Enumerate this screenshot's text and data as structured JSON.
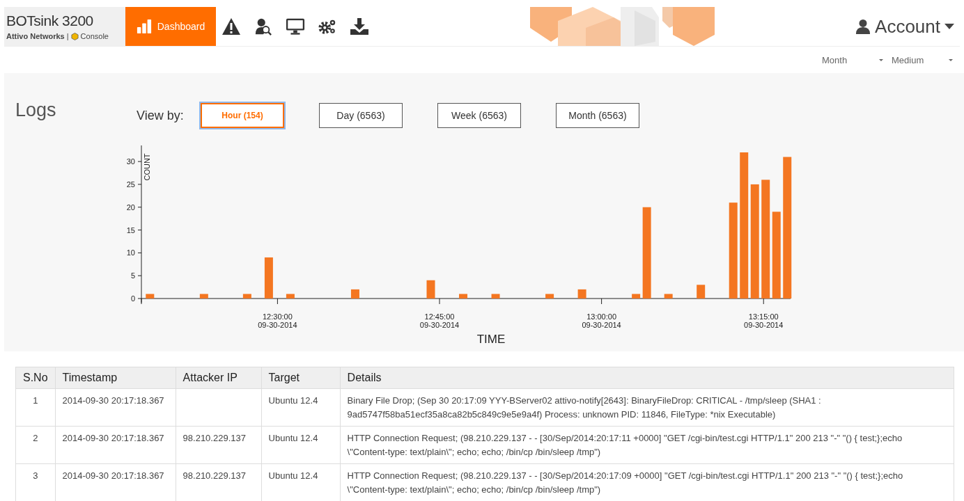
{
  "header": {
    "product": "BOTsink 3200",
    "company": "Attivo Networks",
    "separator": "|",
    "console": "Console",
    "nav": [
      {
        "kind": "tab",
        "label": "Dashboard",
        "selected": true
      },
      {
        "kind": "icon",
        "selected": false
      },
      {
        "kind": "icon",
        "selected": false
      },
      {
        "kind": "icon",
        "selected": false
      },
      {
        "kind": "icon",
        "selected": false
      },
      {
        "kind": "icon",
        "selected": false
      }
    ],
    "account": "Account"
  },
  "filters": [
    "Month",
    "Medium"
  ],
  "logs": {
    "title": "Logs",
    "view_by_label": "View by:",
    "views": [
      {
        "label": "Hour (154)",
        "selected": true
      },
      {
        "label": "Day (6563)",
        "selected": false
      },
      {
        "label": "Week (6563)",
        "selected": false
      },
      {
        "label": "Month (6563)",
        "selected": false
      }
    ],
    "chart_data": {
      "type": "bar",
      "xlabel": "TIME",
      "ylabel": "COUNT",
      "categories": [
        null,
        null,
        null,
        null,
        null,
        null,
        null,
        null,
        null,
        null,
        null,
        null,
        "12:30:00 09-30-2014",
        null,
        null,
        null,
        null,
        null,
        null,
        null,
        null,
        null,
        null,
        null,
        null,
        null,
        null,
        "12:45:00 09-30-2014",
        null,
        null,
        null,
        null,
        null,
        null,
        null,
        null,
        null,
        null,
        null,
        null,
        null,
        null,
        "13:00:00 09-30-2014",
        null,
        null,
        null,
        null,
        null,
        null,
        null,
        null,
        null,
        null,
        null,
        null,
        null,
        null,
        "13:15:00 09-30-2014",
        null,
        null
      ],
      "series": [
        {
          "color": "#f47621",
          "values": [
            1,
            null,
            null,
            null,
            null,
            1,
            null,
            null,
            null,
            1,
            null,
            9,
            null,
            1,
            null,
            null,
            null,
            null,
            null,
            2,
            null,
            null,
            null,
            null,
            null,
            null,
            4,
            null,
            null,
            1,
            null,
            null,
            1,
            null,
            null,
            null,
            null,
            1,
            null,
            null,
            2,
            null,
            null,
            null,
            null,
            1,
            20,
            null,
            1,
            null,
            null,
            3,
            null,
            null,
            21,
            32,
            25,
            26,
            19,
            31
          ]
        }
      ],
      "ylim": [
        0,
        32
      ],
      "yticks": [
        0,
        5,
        10,
        15,
        20,
        25,
        30
      ]
    }
  },
  "table": {
    "columns": [
      "S.No",
      "Timestamp",
      "Attacker IP",
      "Target",
      "Details"
    ],
    "rows": [
      [
        "1",
        "2014-09-30 20:17:18.367",
        "",
        "Ubuntu 12.4",
        "Binary File Drop; (Sep 30 20:17:09 YYY-BServer02 attivo-notify[2643]: BinaryFileDrop: CRITICAL - /tmp/sleep (SHA1 : 9ad5747f58ba51ecf35a8ca82b5c849c9e5e9a4f) Process: unknown PID: 11846, FileType: *nix Executable)"
      ],
      [
        "2",
        "2014-09-30 20:17:18.367",
        "98.210.229.137",
        "Ubuntu 12.4",
        "HTTP Connection Request; (98.210.229.137 - - [30/Sep/2014:20:17:11 +0000] \"GET /cgi-bin/test.cgi HTTP/1.1\" 200 213 \"-\" \"() { test;};echo \\\"Content-type: text/plain\\\"; echo; echo; /bin/cp /bin/sleep /tmp\")"
      ],
      [
        "3",
        "2014-09-30 20:17:18.367",
        "98.210.229.137",
        "Ubuntu 12.4",
        "HTTP Connection Request; (98.210.229.137 - - [30/Sep/2014:20:17:09 +0000] \"GET /cgi-bin/test.cgi HTTP/1.1\" 200 213 \"-\" \"() { test;};echo \\\"Content-type: text/plain\\\"; echo; echo; /bin/cp /bin/sleep /tmp\")"
      ]
    ]
  }
}
